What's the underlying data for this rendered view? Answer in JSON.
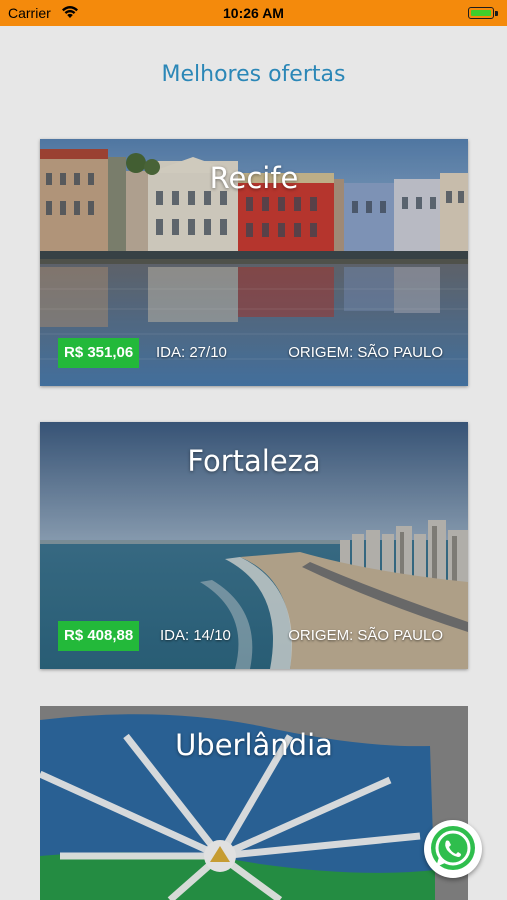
{
  "status_bar": {
    "carrier": "Carrier",
    "time": "10:26 AM",
    "battery_color": "#3fce2b",
    "bar_color": "#f48a0c"
  },
  "header": {
    "title": "Melhores ofertas",
    "title_color": "#2b87b7"
  },
  "offers": [
    {
      "city": "Recife",
      "price": "R$ 351,06",
      "departure": "IDA: 27/10",
      "origin": "ORIGEM: SÃO PAULO"
    },
    {
      "city": "Fortaleza",
      "price": "R$ 408,88",
      "departure": "IDA: 14/10",
      "origin": "ORIGEM: SÃO PAULO"
    },
    {
      "city": "Uberlândia"
    }
  ],
  "price_badge_color": "#23b93a",
  "floating_action": {
    "icon": "whatsapp-icon"
  }
}
